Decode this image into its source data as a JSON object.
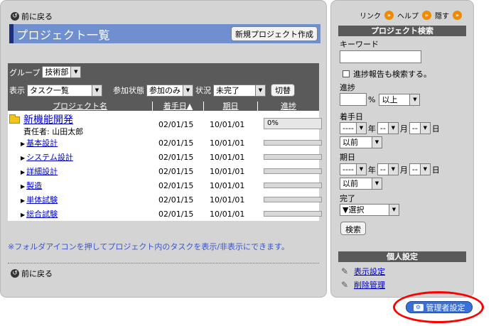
{
  "nav": {
    "back_label": "前に戻る"
  },
  "header": {
    "title": "プロジェクト一覧",
    "new_project_label": "新規プロジェクト作成"
  },
  "filters": {
    "group_label": "グループ",
    "group_value": "技術部",
    "display_label": "表示",
    "display_value": "タスク一覧",
    "participation_label": "参加状態",
    "participation_value": "参加のみ",
    "status_label": "状況",
    "status_value": "未完了",
    "toggle_label": "切替"
  },
  "table": {
    "headers": {
      "name": "プロジェクト名",
      "start": "着手日▲",
      "due": "期日",
      "progress": "進捗"
    },
    "project": {
      "name": "新機能開発",
      "owner": "責任者: 山田太郎",
      "start": "02/01/15",
      "due": "10/01/01",
      "progress_text": "0%",
      "progress": 0
    },
    "tasks": [
      {
        "name": "基本設計",
        "start": "02/01/15",
        "due": "10/01/01",
        "progress": 0
      },
      {
        "name": "システム設計",
        "start": "02/01/15",
        "due": "10/01/01",
        "progress": 0
      },
      {
        "name": "詳細設計",
        "start": "02/01/15",
        "due": "10/01/01",
        "progress": 0
      },
      {
        "name": "製造",
        "start": "02/01/15",
        "due": "10/01/01",
        "progress": 0
      },
      {
        "name": "単体試験",
        "start": "02/01/15",
        "due": "10/01/01",
        "progress": 0
      },
      {
        "name": "総合試験",
        "start": "02/01/15",
        "due": "10/01/01",
        "progress": 0
      }
    ]
  },
  "note": "※フォルダアイコンを押してプロジェクト内のタスクを表示/非表示にできます。",
  "side": {
    "links": {
      "link": "リンク",
      "help": "ヘルプ",
      "hide": "隠す"
    },
    "search": {
      "title": "プロジェクト検索",
      "keyword_label": "キーワード",
      "include_reports_label": "進捗報告も検索する。",
      "progress_label": "進捗",
      "percent": "%",
      "progress_op": "以上",
      "start_label": "着手日",
      "due_label": "期日",
      "blank": "----",
      "blank_short": "--",
      "year": "年",
      "month": "月",
      "day": "日",
      "before": "以前",
      "complete_label": "完了",
      "complete_value": "▼選択",
      "search_button": "検索"
    },
    "personal": {
      "title": "個人設定",
      "display_settings": "表示設定",
      "delete_management": "削除管理"
    }
  },
  "admin": {
    "label": "管理者設定"
  },
  "colors": {
    "accent": "#6f8fcf",
    "header_dark": "#5a5a5a",
    "admin": "#3a6fd6",
    "highlight": "#ff0000"
  }
}
